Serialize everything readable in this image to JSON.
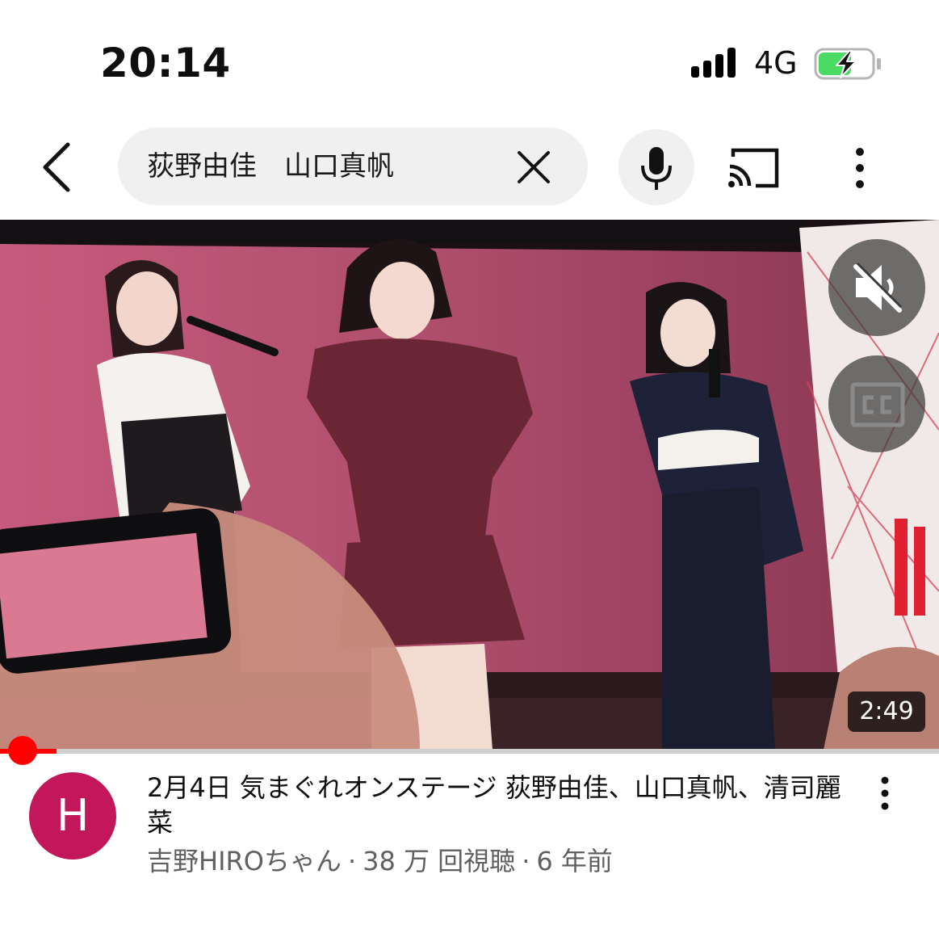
{
  "status_bar": {
    "time": "20:14",
    "network": "4G",
    "signal_bars": 4,
    "battery_charging": true,
    "battery_color": "#4cd964"
  },
  "top_bar": {
    "back_icon": "chevron-left-icon",
    "search_query": "荻野由佳　山口真帆",
    "clear_icon": "close-icon",
    "mic_icon": "microphone-icon",
    "cast_icon": "cast-icon",
    "more_icon": "more-vertical-icon"
  },
  "player": {
    "mute_icon": "volume-off-icon",
    "cc_icon": "closed-captions-icon",
    "duration": "2:49",
    "progress_fraction": 0.06,
    "progress_color": "#ff0000"
  },
  "video": {
    "title": "2月4日 気まぐれオンステージ 荻野由佳、山口真帆、清司麗菜",
    "channel_initial": "H",
    "avatar_color": "#c2185b",
    "channel": "吉野HIROちゃん",
    "views": "38 万 回視聴",
    "age": "6 年前",
    "separator": "·"
  }
}
